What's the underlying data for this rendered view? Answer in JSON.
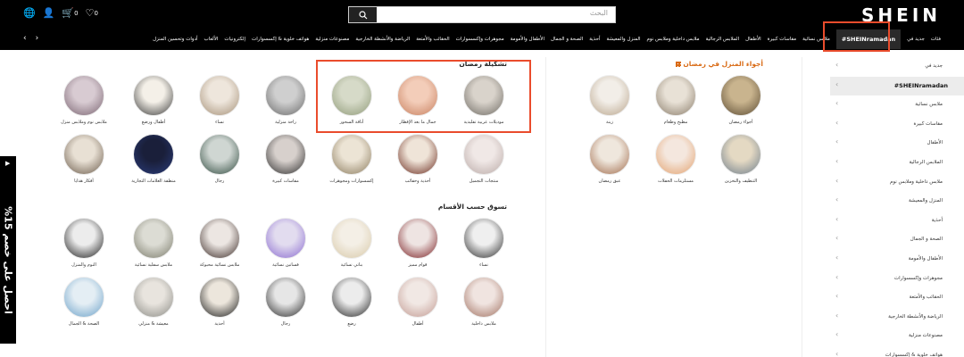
{
  "header": {
    "logo": "SHEIN",
    "search_placeholder": "البحث",
    "icons": [
      {
        "name": "globe-icon",
        "glyph": "🌐",
        "count": ""
      },
      {
        "name": "person-icon",
        "glyph": "👤",
        "count": ""
      },
      {
        "name": "cart-icon",
        "glyph": "🛒",
        "count": "0"
      },
      {
        "name": "heart-icon",
        "glyph": "♡",
        "count": "0"
      }
    ]
  },
  "nav": {
    "items": [
      {
        "label": "فئات",
        "active": false
      },
      {
        "label": "جديد في",
        "active": false
      },
      {
        "label": "SHEINramadan#",
        "active": true
      },
      {
        "label": "ملابس نسائية",
        "active": false
      },
      {
        "label": "مقاسات كبيرة",
        "active": false
      },
      {
        "label": "الأطفال",
        "active": false
      },
      {
        "label": "الملابس الرجالية",
        "active": false
      },
      {
        "label": "ملابس داخلية وملابس نوم",
        "active": false
      },
      {
        "label": "المنزل والمعيشة",
        "active": false
      },
      {
        "label": "أحذية",
        "active": false
      },
      {
        "label": "الصحة و الجمال",
        "active": false
      },
      {
        "label": "الأطفال والأمومة",
        "active": false
      },
      {
        "label": "مجوهرات وإكسسوارات",
        "active": false
      },
      {
        "label": "الحقائب والأمتعة",
        "active": false
      },
      {
        "label": "الرياضة والأنشطة الخارجية",
        "active": false
      },
      {
        "label": "مصنوعات منزلية",
        "active": false
      },
      {
        "label": "هواتف خلوية & إكسسوارات",
        "active": false
      },
      {
        "label": "إلكترونيات",
        "active": false
      },
      {
        "label": "الألعاب",
        "active": false
      },
      {
        "label": "أدوات وتحسين المنزل",
        "active": false
      }
    ]
  },
  "sidebar": {
    "items": [
      {
        "label": "جديد في",
        "active": false
      },
      {
        "label": "SHEINramadan#",
        "active": true
      },
      {
        "label": "ملابس نسائية",
        "active": false
      },
      {
        "label": "مقاسات كبيرة",
        "active": false
      },
      {
        "label": "الأطفال",
        "active": false
      },
      {
        "label": "الملابس الرجالية",
        "active": false
      },
      {
        "label": "ملابس داخلية وملابس نوم",
        "active": false
      },
      {
        "label": "المنزل والمعيشة",
        "active": false
      },
      {
        "label": "أحذية",
        "active": false
      },
      {
        "label": "الصحة و الجمال",
        "active": false
      },
      {
        "label": "الأطفال والأمومة",
        "active": false
      },
      {
        "label": "مجوهرات وإكسسوارات",
        "active": false
      },
      {
        "label": "الحقائب والأمتعة",
        "active": false
      },
      {
        "label": "الرياضة والأنشطة الخارجية",
        "active": false
      },
      {
        "label": "مصنوعات منزلية",
        "active": false
      },
      {
        "label": "هواتف خلوية & إكسسوارات",
        "active": false
      }
    ]
  },
  "promo": {
    "text": "احصل على خصم 15%"
  },
  "sections": {
    "home_title": "أجواء المنزل في رمضان",
    "ramadan_title": "تشكيلة رمضان",
    "shop_title": "تسوق حسب الأقسام"
  },
  "home_items": [
    {
      "label": "أجواء رمضان",
      "c1": "#c9b48e",
      "c2": "#5a4a32"
    },
    {
      "label": "مطبخ وطعام",
      "c1": "#e8e1d6",
      "c2": "#8a7c6a"
    },
    {
      "label": "زينة",
      "c1": "#f2eee8",
      "c2": "#b9a58c"
    },
    {
      "label": "التنظيف والتخزين",
      "c1": "#e4d9c3",
      "c2": "#6c7c8a"
    },
    {
      "label": "مستلزمات الحفلات",
      "c1": "#f4e7de",
      "c2": "#e3a16d"
    },
    {
      "label": "عبق رمضان",
      "c1": "#efe7dd",
      "c2": "#a06a4a"
    }
  ],
  "ramadan_items": [
    {
      "label": "موديلات عربية تقليدية",
      "c1": "#d9d3cb",
      "c2": "#6e6a63"
    },
    {
      "label": "جمال ما بعد الإفطار",
      "c1": "#f3cdb9",
      "c2": "#c77f5e"
    },
    {
      "label": "أناقة السحور",
      "c1": "#d6dac8",
      "c2": "#8f9a78"
    },
    {
      "label": "راحة منزلية",
      "c1": "#cfcfcf",
      "c2": "#6a6a6a"
    },
    {
      "label": "نساء",
      "c1": "#eee6dc",
      "c2": "#a59077"
    },
    {
      "label": "أطفال ورضع",
      "c1": "#f4f0e8",
      "c2": "#3a3a3a"
    },
    {
      "label": "ملابس نوم وملابس منزل",
      "c1": "#d8cbd2",
      "c2": "#7a6471"
    }
  ],
  "row2_items": [
    {
      "label": "منتجات التجميل",
      "c1": "#f0e8e6",
      "c2": "#b9a9a6"
    },
    {
      "label": "أحذية وحقائب",
      "c1": "#efe4d8",
      "c2": "#6a2a1e"
    },
    {
      "label": "إكسسوارات ومجوهرات",
      "c1": "#ece4d5",
      "c2": "#8a7a5c"
    },
    {
      "label": "مقاسات كبيرة",
      "c1": "#d7d0cc",
      "c2": "#2c2c2c"
    },
    {
      "label": "رجال",
      "c1": "#cfd6d2",
      "c2": "#2f4a3e"
    },
    {
      "label": "منطقة العلامات التجارية",
      "c1": "#1a1f3a",
      "c2": "#2a3c7a"
    },
    {
      "label": "أفكار هدايا",
      "c1": "#e8e0d4",
      "c2": "#6a5a4a"
    }
  ],
  "shop_row1": [
    {
      "label": "نساء",
      "c1": "#efefef",
      "c2": "#2a2a2a"
    },
    {
      "label": "قوام مميز",
      "c1": "#eee4e2",
      "c2": "#7a1e22"
    },
    {
      "label": "بناتي نسائية",
      "c1": "#f4efe6",
      "c2": "#d8c9a8"
    },
    {
      "label": "فساتين نسائية",
      "c1": "#e2dcef",
      "c2": "#8a6ad0"
    },
    {
      "label": "ملابس نسائية محبوكة",
      "c1": "#ece6e2",
      "c2": "#3a2a26"
    },
    {
      "label": "ملابس سفلية نسائية",
      "c1": "#dcdcd4",
      "c2": "#7a7a6a"
    },
    {
      "label": "النوم والمنزل",
      "c1": "#ececec",
      "c2": "#1a1a1a"
    }
  ],
  "shop_row2": [
    {
      "label": "ملابس داخلية",
      "c1": "#f0e4e0",
      "c2": "#a07060"
    },
    {
      "label": "أطفال",
      "c1": "#f1e8e4",
      "c2": "#c29a92"
    },
    {
      "label": "رضع",
      "c1": "#ececec",
      "c2": "#222222"
    },
    {
      "label": "رجال",
      "c1": "#e6e6e6",
      "c2": "#2a2a2a"
    },
    {
      "label": "أحذية",
      "c1": "#ece6dc",
      "c2": "#1a1a1a"
    },
    {
      "label": "معيشة & منزلي",
      "c1": "#e8e4de",
      "c2": "#8a8a84"
    },
    {
      "label": "الصحة & الجمال",
      "c1": "#e4eef4",
      "c2": "#6aa0c8"
    }
  ]
}
